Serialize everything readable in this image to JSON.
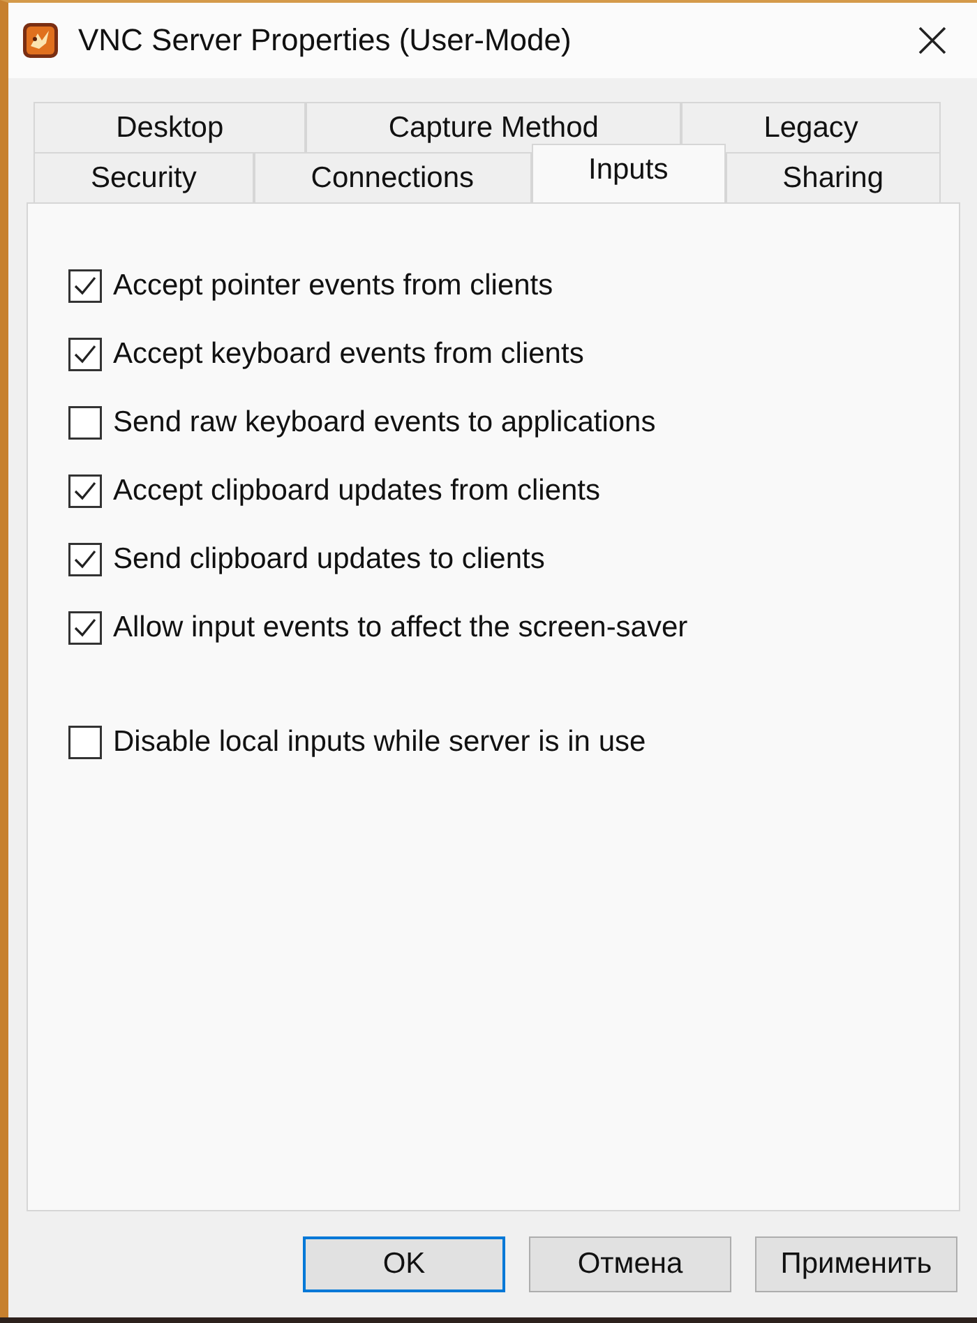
{
  "window": {
    "title": "VNC Server Properties (User-Mode)"
  },
  "tab_rows": [
    {
      "tabs": [
        {
          "label": "Desktop",
          "selected": false
        },
        {
          "label": "Capture Method",
          "selected": false
        },
        {
          "label": "Legacy",
          "selected": false
        }
      ]
    },
    {
      "tabs": [
        {
          "label": "Security",
          "selected": false
        },
        {
          "label": "Connections",
          "selected": false
        },
        {
          "label": "Inputs",
          "selected": true
        },
        {
          "label": "Sharing",
          "selected": false
        }
      ]
    }
  ],
  "option_groups": [
    {
      "options": [
        {
          "label": "Accept pointer events from clients",
          "checked": true
        },
        {
          "label": "Accept keyboard events from clients",
          "checked": true
        },
        {
          "label": "Send raw keyboard events to applications",
          "checked": false
        },
        {
          "label": "Accept clipboard updates from clients",
          "checked": true
        },
        {
          "label": "Send clipboard updates to clients",
          "checked": true
        },
        {
          "label": "Allow input events to affect the screen-saver",
          "checked": true
        }
      ]
    },
    {
      "options": [
        {
          "label": "Disable local inputs while server is in use",
          "checked": false
        }
      ]
    }
  ],
  "buttons": [
    {
      "label": "OK",
      "default": true
    },
    {
      "label": "Отмена",
      "default": false
    },
    {
      "label": "Применить",
      "default": false
    }
  ]
}
